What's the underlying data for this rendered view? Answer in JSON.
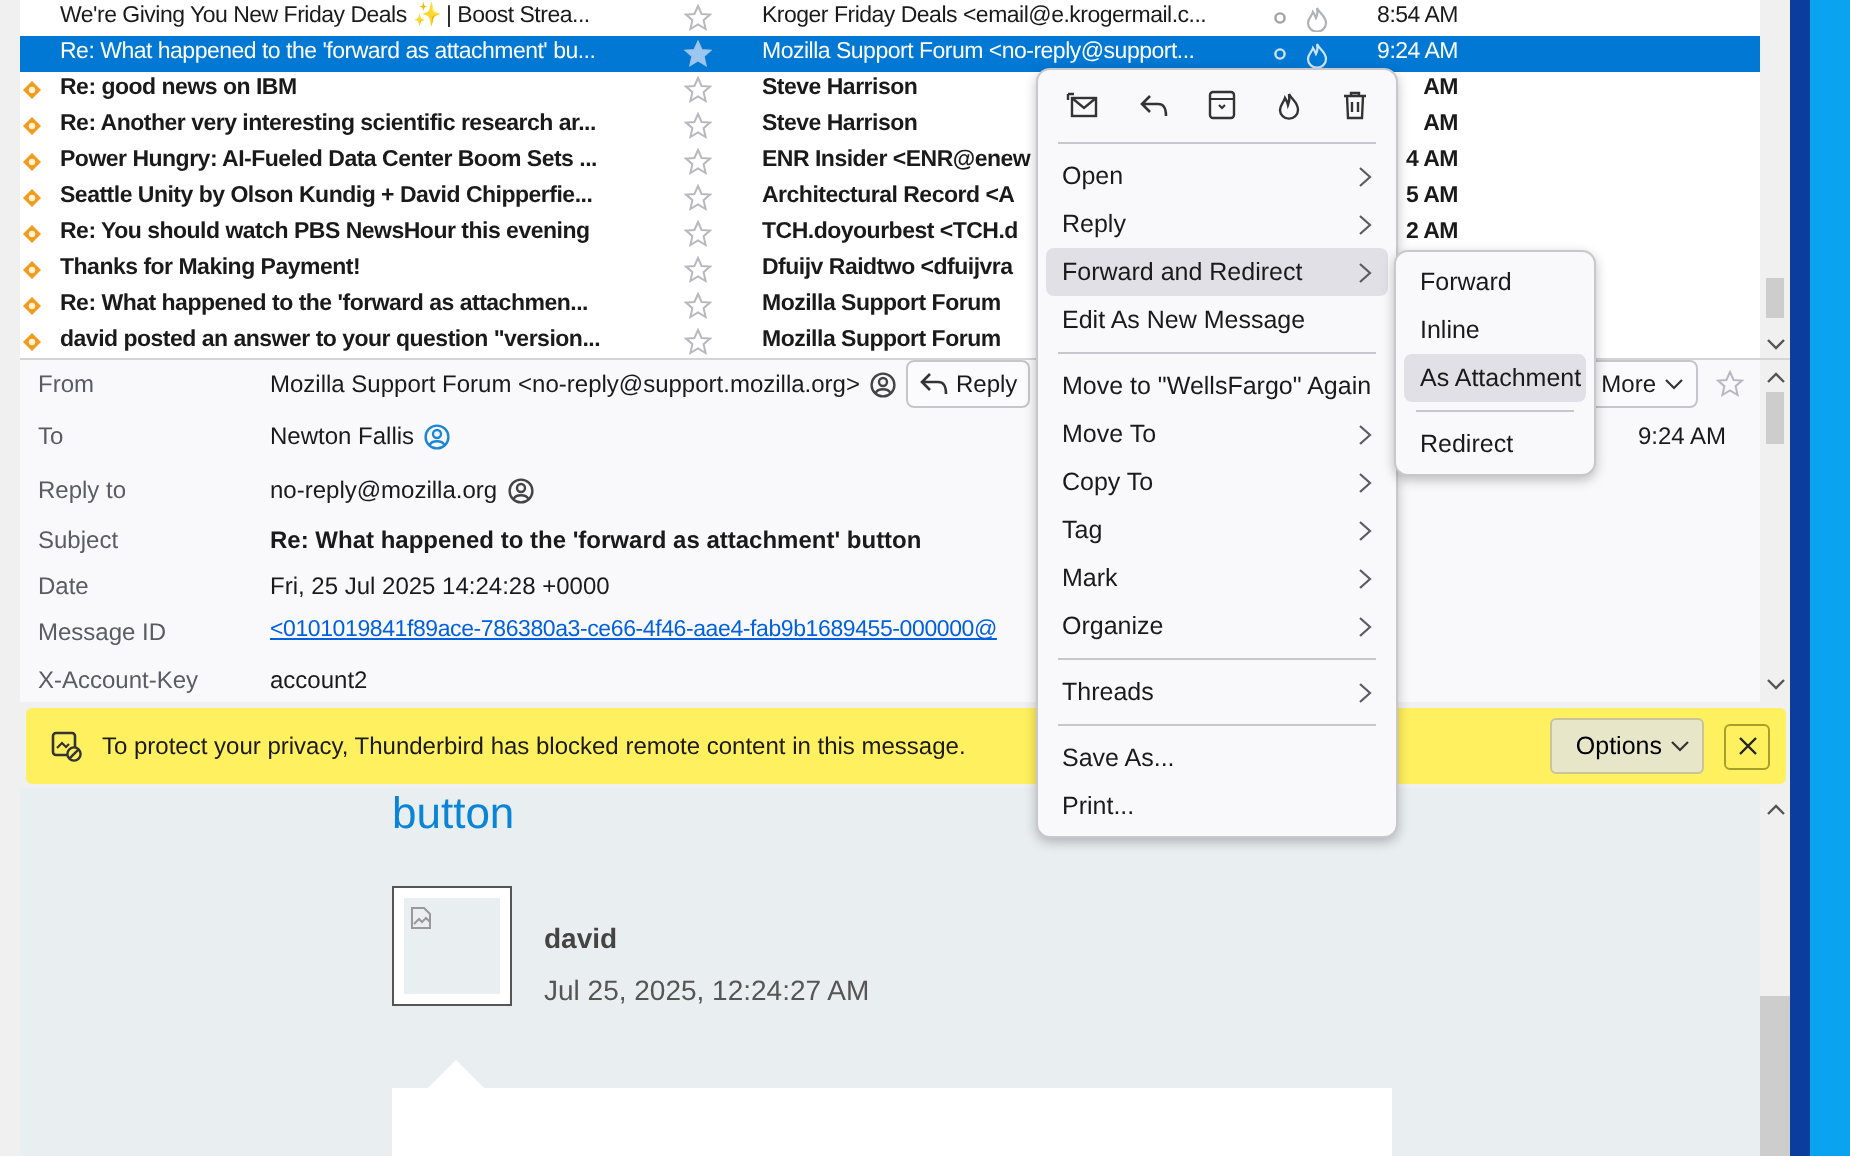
{
  "message_list": {
    "rows": [
      {
        "subject": "We're Giving You New Friday Deals ✨ | Boost Strea...",
        "unread": false,
        "selected": false,
        "sender": "Kroger Friday Deals <email@e.krogermail.c...",
        "date": "8:54 AM"
      },
      {
        "subject": "Re: What happened to the 'forward as attachment' bu...",
        "unread": false,
        "selected": true,
        "sender": "Mozilla Support Forum <no-reply@support...",
        "date": "9:24 AM"
      },
      {
        "subject": "Re: good news on IBM",
        "unread": true,
        "selected": false,
        "sender": "Steve Harrison",
        "date": "AM"
      },
      {
        "subject": "Re: Another very interesting scientific research ar...",
        "unread": true,
        "selected": false,
        "sender": "Steve Harrison",
        "date": "AM"
      },
      {
        "subject": "Power Hungry: AI-Fueled Data Center Boom Sets ...",
        "unread": true,
        "selected": false,
        "sender": "ENR Insider <ENR@enew",
        "date": "4 AM"
      },
      {
        "subject": "Seattle Unity by Olson Kundig + David Chipperfie...",
        "unread": true,
        "selected": false,
        "sender": "Architectural Record <A",
        "date": "5 AM"
      },
      {
        "subject": "Re: You should watch PBS NewsHour this evening",
        "unread": true,
        "selected": false,
        "sender": "TCH.doyourbest <TCH.d",
        "date": "2 AM"
      },
      {
        "subject": "Thanks for Making Payment!",
        "unread": true,
        "selected": false,
        "sender": "Dfuijv Raidtwo <dfuijvra"
      },
      {
        "subject": "Re: What happened to the 'forward as attachmen...",
        "unread": true,
        "selected": false,
        "sender": "Mozilla Support Forum"
      },
      {
        "subject": "david posted an answer to your question \"version...",
        "unread": true,
        "selected": false,
        "sender": "Mozilla Support Forum"
      }
    ]
  },
  "message_header": {
    "reply_button": "Reply",
    "more_button": "More",
    "time": "9:24 AM",
    "fields": [
      {
        "label": "From",
        "value": "Mozilla Support Forum <no-reply@support.mozilla.org>",
        "kind": "contact"
      },
      {
        "label": "To",
        "value": "Newton Fallis",
        "kind": "known_contact"
      },
      {
        "label": "Reply to",
        "value": "no-reply@mozilla.org",
        "kind": "contact"
      },
      {
        "label": "Subject",
        "value": "Re: What happened to the 'forward as attachment' button",
        "kind": "subject"
      },
      {
        "label": "Date",
        "value": "Fri, 25 Jul 2025 14:24:28 +0000",
        "kind": "text"
      },
      {
        "label": "Message ID",
        "value": "<0101019841f89ace-786380a3-ce66-4f46-aae4-fab9b1689455-000000@",
        "kind": "link"
      },
      {
        "label": "X-Account-Key",
        "value": "account2",
        "kind": "text"
      }
    ]
  },
  "notification": {
    "text": "To protect your privacy, Thunderbird has blocked remote content in this message.",
    "options_button": "Options"
  },
  "message_body": {
    "heading": "button",
    "author": "david",
    "posted": "Jul 25, 2025, 12:24:27 AM"
  },
  "context_menu": {
    "items": [
      {
        "kind": "item",
        "label": "Open",
        "submenu": true,
        "selected": false
      },
      {
        "kind": "item",
        "label": "Reply",
        "submenu": true,
        "selected": false
      },
      {
        "kind": "item",
        "label": "Forward and Redirect",
        "submenu": true,
        "selected": true
      },
      {
        "kind": "item",
        "label": "Edit As New Message",
        "submenu": false,
        "selected": false
      },
      {
        "kind": "separator"
      },
      {
        "kind": "item",
        "label": "Move to \"WellsFargo\" Again",
        "submenu": false,
        "selected": false
      },
      {
        "kind": "item",
        "label": "Move To",
        "submenu": true,
        "selected": false
      },
      {
        "kind": "item",
        "label": "Copy To",
        "submenu": true,
        "selected": false
      },
      {
        "kind": "item",
        "label": "Tag",
        "submenu": true,
        "selected": false
      },
      {
        "kind": "item",
        "label": "Mark",
        "submenu": true,
        "selected": false
      },
      {
        "kind": "item",
        "label": "Organize",
        "submenu": true,
        "selected": false
      },
      {
        "kind": "separator"
      },
      {
        "kind": "item",
        "label": "Threads",
        "submenu": true,
        "selected": false
      },
      {
        "kind": "separator"
      },
      {
        "kind": "item",
        "label": "Save As...",
        "submenu": false,
        "selected": false
      },
      {
        "kind": "item",
        "label": "Print...",
        "submenu": false,
        "selected": false
      }
    ]
  },
  "submenu": {
    "items": [
      {
        "kind": "item",
        "label": "Forward",
        "selected": false
      },
      {
        "kind": "item",
        "label": "Inline",
        "selected": false
      },
      {
        "kind": "item",
        "label": "As Attachment",
        "selected": true
      },
      {
        "kind": "separator"
      },
      {
        "kind": "item",
        "label": "Redirect",
        "selected": false
      }
    ]
  }
}
